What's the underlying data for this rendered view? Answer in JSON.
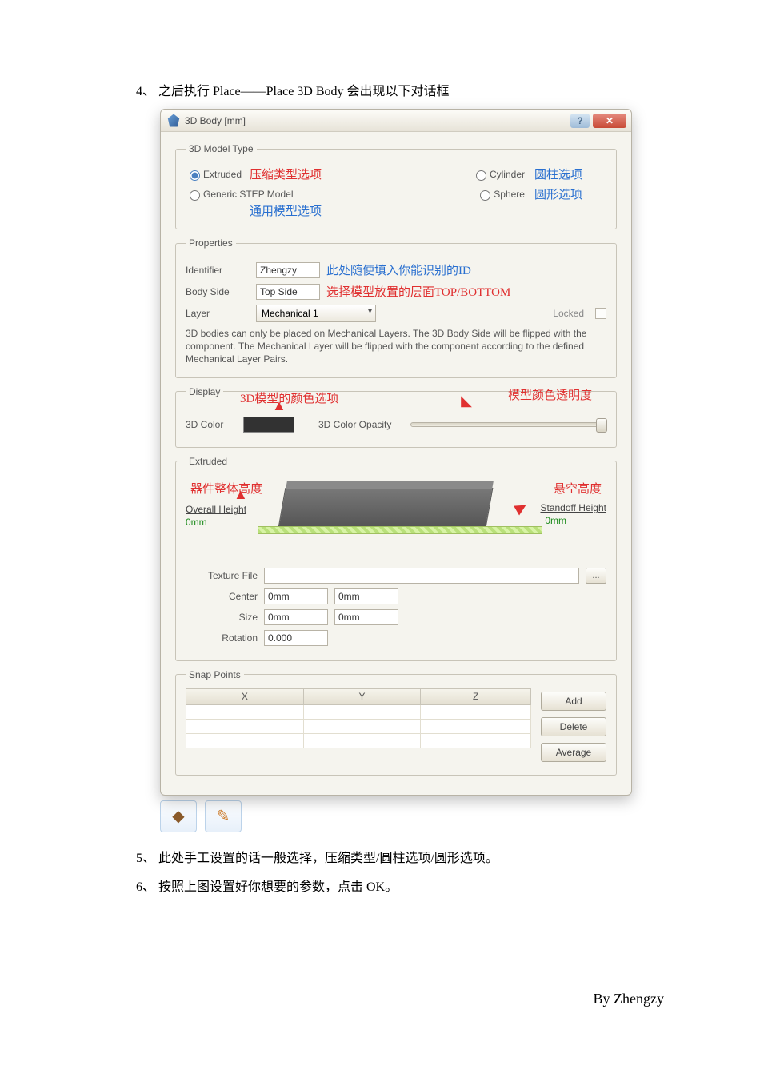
{
  "doc": {
    "step4": "4、 之后执行 Place——Place 3D Body 会出现以下对话框",
    "step5": "5、 此处手工设置的话一般选择，压缩类型/圆柱选项/圆形选项。",
    "step6": "6、 按照上图设置好你想要的参数，点击 OK。",
    "footer": "By Zhengzy"
  },
  "window": {
    "title": "3D Body [mm]",
    "help": "?",
    "close": "✕"
  },
  "modelType": {
    "legend": "3D Model Type",
    "extruded": "Extruded",
    "extruded_anno": "压缩类型选项",
    "cylinder": "Cylinder",
    "cylinder_anno": "圆柱选项",
    "step": "Generic STEP Model",
    "step_anno": "通用模型选项",
    "sphere": "Sphere",
    "sphere_anno": "圆形选项"
  },
  "properties": {
    "legend": "Properties",
    "identifier_lbl": "Identifier",
    "identifier_val": "Zhengzy",
    "identifier_anno": "此处随便填入你能识别的ID",
    "bodyside_lbl": "Body Side",
    "bodyside_val": "Top Side",
    "bodyside_anno": "选择模型放置的层面TOP/BOTTOM",
    "layer_lbl": "Layer",
    "layer_val": "Mechanical 1",
    "locked_lbl": "Locked",
    "note": "3D bodies can only be placed on Mechanical Layers. The 3D Body Side will be flipped with the component. The Mechanical Layer will be flipped with the component according to the defined Mechanical Layer Pairs."
  },
  "display": {
    "legend": "Display",
    "anno_left": "3D模型的颜色选项",
    "anno_right": "模型颜色透明度",
    "color_lbl": "3D Color",
    "opacity_lbl": "3D Color Opacity"
  },
  "extruded": {
    "legend": "Extruded",
    "anno_overall": "器件整体高度",
    "anno_standoff": "悬空高度",
    "overall_lbl": "Overall Height",
    "overall_val": "0mm",
    "standoff_lbl": "Standoff Height",
    "standoff_val": "0mm",
    "texture_lbl": "Texture File",
    "browse": "...",
    "center_lbl": "Center",
    "center_x": "0mm",
    "center_y": "0mm",
    "size_lbl": "Size",
    "size_x": "0mm",
    "size_y": "0mm",
    "rotation_lbl": "Rotation",
    "rotation_val": "0.000"
  },
  "snap": {
    "legend": "Snap Points",
    "colX": "X",
    "colY": "Y",
    "colZ": "Z",
    "add": "Add",
    "del": "Delete",
    "avg": "Average"
  }
}
